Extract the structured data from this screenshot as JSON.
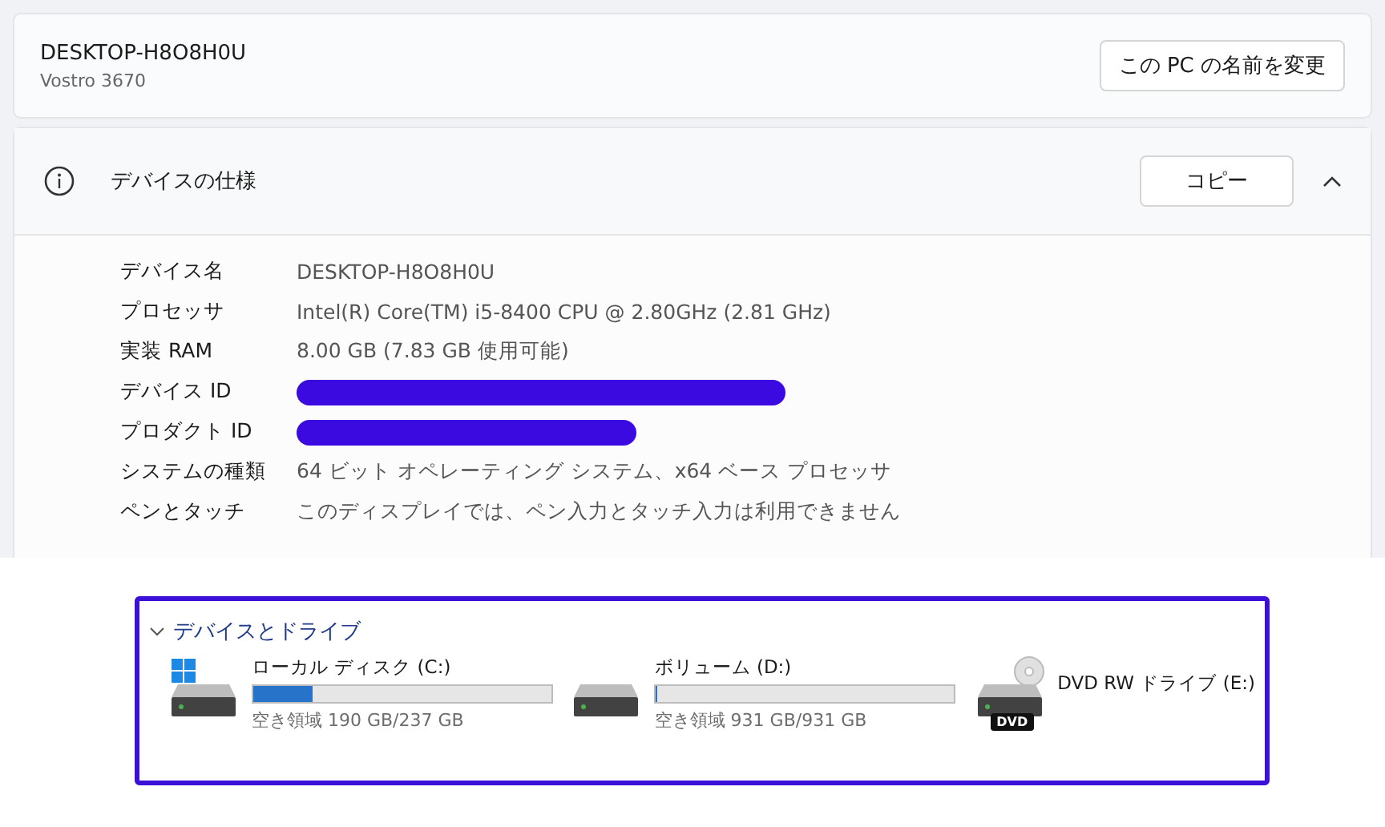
{
  "pc_card": {
    "name": "DESKTOP-H8O8H0U",
    "model": "Vostro 3670",
    "rename_button": "この PC の名前を変更"
  },
  "spec_section": {
    "title": "デバイスの仕様",
    "copy_button": "コピー",
    "expanded": true,
    "rows": [
      {
        "kind": "text",
        "label": "デバイス名",
        "value": "DESKTOP-H8O8H0U"
      },
      {
        "kind": "text",
        "label": "プロセッサ",
        "value": "Intel(R) Core(TM) i5-8400 CPU @ 2.80GHz (2.81 GHz)"
      },
      {
        "kind": "text",
        "label": "実装 RAM",
        "value": "8.00 GB (7.83 GB 使用可能)"
      },
      {
        "kind": "redacted",
        "label": "デバイス ID"
      },
      {
        "kind": "redacted",
        "label": "プロダクト ID"
      },
      {
        "kind": "text",
        "label": "システムの種類",
        "value": "64 ビット オペレーティング システム、x64 ベース プロセッサ"
      },
      {
        "kind": "text",
        "label": "ペンとタッチ",
        "value": "このディスプレイでは、ペン入力とタッチ入力は利用できません"
      }
    ]
  },
  "drives_section": {
    "title": "デバイスとドライブ",
    "expanded": true,
    "drives": [
      {
        "kind": "system",
        "name": "ローカル ディスク (C:)",
        "level": 0.2,
        "free": "空き領域 190 GB/237 GB"
      },
      {
        "kind": "disk",
        "name": "ボリューム (D:)",
        "level": 0.0,
        "free": "空き領域 931 GB/931 GB"
      },
      {
        "kind": "dvd",
        "name": "DVD RW ドライブ (E:)",
        "icon_label": "DVD"
      }
    ]
  }
}
